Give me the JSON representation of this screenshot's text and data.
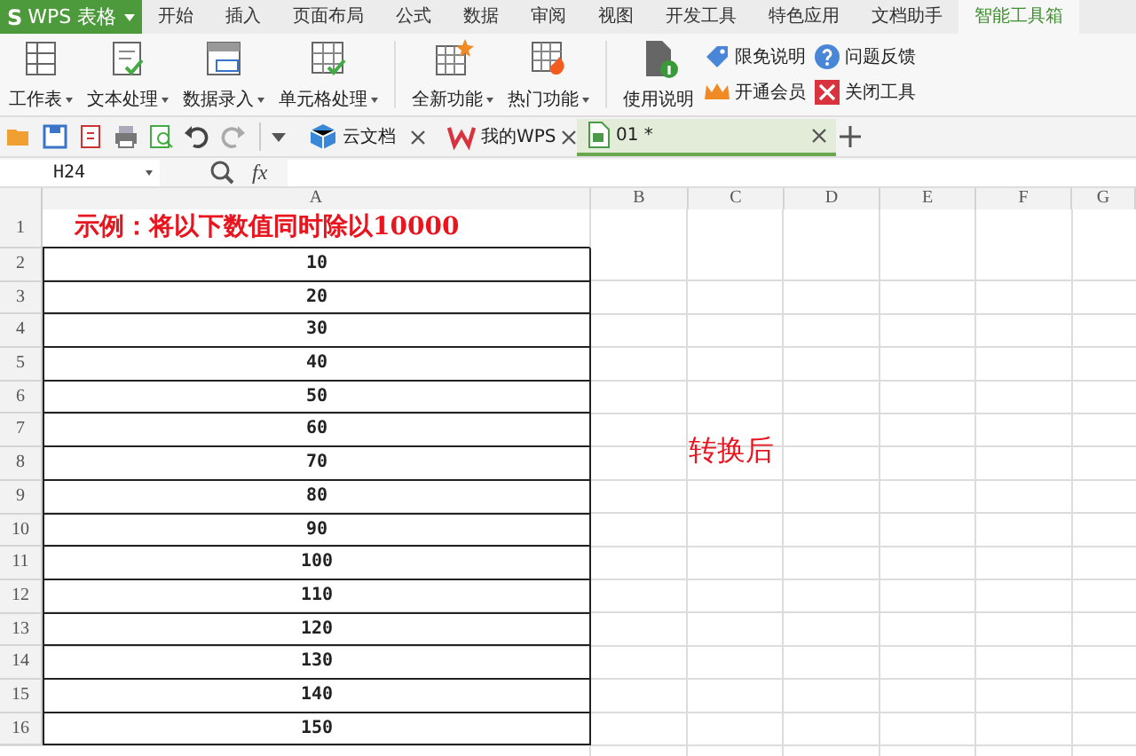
{
  "app_menu": {
    "logo": "S",
    "title": "WPS 表格"
  },
  "menu_tabs": [
    {
      "label": "开始",
      "selected": false
    },
    {
      "label": "插入",
      "selected": false
    },
    {
      "label": "页面布局",
      "selected": false
    },
    {
      "label": "公式",
      "selected": false
    },
    {
      "label": "数据",
      "selected": false
    },
    {
      "label": "审阅",
      "selected": false
    },
    {
      "label": "视图",
      "selected": false
    },
    {
      "label": "开发工具",
      "selected": false
    },
    {
      "label": "特色应用",
      "selected": false
    },
    {
      "label": "文档助手",
      "selected": false
    },
    {
      "label": "智能工具箱",
      "selected": true
    }
  ],
  "ribbon_groups": [
    {
      "buttons": [
        {
          "label": "工作表",
          "dropdown": true
        },
        {
          "label": "文本处理",
          "dropdown": true
        },
        {
          "label": "数据录入",
          "dropdown": true
        },
        {
          "label": "单元格处理",
          "dropdown": true
        }
      ]
    },
    {
      "buttons": [
        {
          "label": "全新功能",
          "dropdown": true
        },
        {
          "label": "热门功能",
          "dropdown": true
        }
      ]
    },
    {
      "buttons": [
        {
          "label": "使用说明",
          "dropdown": false
        }
      ],
      "links": [
        "限免说明",
        "问题反馈",
        "开通会员",
        "关闭工具"
      ]
    }
  ],
  "doc_tabs": [
    {
      "label": "云文档",
      "selected": false
    },
    {
      "label": "我的WPS",
      "selected": false
    },
    {
      "label": "01 *",
      "selected": true
    }
  ],
  "name_box": "H24",
  "formula_label": "fx",
  "columns": [
    "A",
    "B",
    "C",
    "D",
    "E",
    "F",
    "G"
  ],
  "rows": [
    {
      "header": "1",
      "kind": "title",
      "value": "示例：将以下数值同时除以10000"
    },
    {
      "header": "2",
      "kind": "number",
      "value": "10"
    },
    {
      "header": "3",
      "kind": "number",
      "value": "20"
    },
    {
      "header": "4",
      "kind": "number",
      "value": "30"
    },
    {
      "header": "5",
      "kind": "number",
      "value": "40"
    },
    {
      "header": "6",
      "kind": "number",
      "value": "50"
    },
    {
      "header": "7",
      "kind": "number",
      "value": "60"
    },
    {
      "header": "8",
      "kind": "number",
      "value": "70"
    },
    {
      "header": "9",
      "kind": "number",
      "value": "80"
    },
    {
      "header": "10",
      "kind": "number",
      "value": "90"
    },
    {
      "header": "11",
      "kind": "number",
      "value": "100"
    },
    {
      "header": "12",
      "kind": "number",
      "value": "110"
    },
    {
      "header": "13",
      "kind": "number",
      "value": "120"
    },
    {
      "header": "14",
      "kind": "number",
      "value": "130"
    },
    {
      "header": "15",
      "kind": "number",
      "value": "140"
    },
    {
      "header": "16",
      "kind": "number",
      "value": "150"
    }
  ],
  "note": "转换后"
}
